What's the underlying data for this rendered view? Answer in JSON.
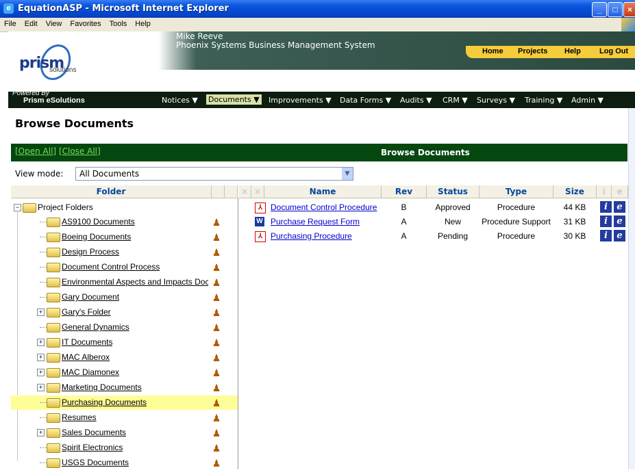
{
  "window": {
    "title": "EquationASP - Microsoft Internet Explorer"
  },
  "menu": [
    "File",
    "Edit",
    "View",
    "Favorites",
    "Tools",
    "Help"
  ],
  "header": {
    "logo_text": "prism",
    "logo_sub": "solutions",
    "user_name": "Mike Reeve",
    "system_name": "Phoenix Systems Business Management System",
    "top_links": [
      "Home",
      "Projects",
      "Help",
      "Log Out"
    ],
    "powered_by": "Powered By",
    "powered_name": "Prism eSolutions"
  },
  "nav": [
    {
      "label": "Notices ▼"
    },
    {
      "label": "Documents ▼"
    },
    {
      "label": "Improvements ▼"
    },
    {
      "label": "Data Forms ▼"
    },
    {
      "label": "Audits ▼"
    },
    {
      "label": "CRM ▼"
    },
    {
      "label": "Surveys ▼"
    },
    {
      "label": "Training ▼"
    },
    {
      "label": "Admin ▼"
    }
  ],
  "page": {
    "title": "Browse Documents",
    "open_all": "[Open All]",
    "close_all": "[Close All]",
    "panel_title": "Browse Documents",
    "view_mode_label": "View mode:",
    "view_mode_value": "All Documents"
  },
  "columns": {
    "folder": "Folder",
    "name": "Name",
    "rev": "Rev",
    "status": "Status",
    "type": "Type",
    "size": "Size"
  },
  "folders": {
    "root": "Project Folders",
    "items": [
      {
        "label": "AS9100 Documents",
        "expandable": false
      },
      {
        "label": "Boeing Documents",
        "expandable": false
      },
      {
        "label": "Design Process",
        "expandable": false
      },
      {
        "label": "Document Control Process",
        "expandable": false
      },
      {
        "label": "Environmental Aspects and Impacts Docu",
        "expandable": false
      },
      {
        "label": "Gary Document",
        "expandable": false
      },
      {
        "label": "Gary's Folder",
        "expandable": true
      },
      {
        "label": "General Dynamics",
        "expandable": false
      },
      {
        "label": "IT Documents",
        "expandable": true
      },
      {
        "label": "MAC Alberox",
        "expandable": true
      },
      {
        "label": "MAC Diamonex",
        "expandable": true
      },
      {
        "label": "Marketing Documents",
        "expandable": true
      },
      {
        "label": "Purchasing Documents",
        "expandable": false,
        "selected": true
      },
      {
        "label": "Resumes",
        "expandable": false
      },
      {
        "label": "Sales Documents",
        "expandable": true
      },
      {
        "label": "Spirit Electronics",
        "expandable": false
      },
      {
        "label": "USGS Documents",
        "expandable": false
      }
    ]
  },
  "documents": [
    {
      "icon": "pdf-icon",
      "name": "Document Control Procedure",
      "rev": "B",
      "status": "Approved",
      "type": "Procedure",
      "size": "44 KB"
    },
    {
      "icon": "word-icon",
      "name": "Purchase Request Form",
      "rev": "A",
      "status": "New",
      "type": "Procedure Support",
      "size": "31 KB"
    },
    {
      "icon": "pdf-icon",
      "name": "Purchasing Procedure",
      "rev": "A",
      "status": "Pending",
      "type": "Procedure",
      "size": "30 KB"
    }
  ],
  "colors": {
    "green_bar": "#04470f",
    "nav_bg": "#0d1d0f",
    "top_links_bg": "#f5cc3b",
    "selected_row": "#fefe99"
  }
}
